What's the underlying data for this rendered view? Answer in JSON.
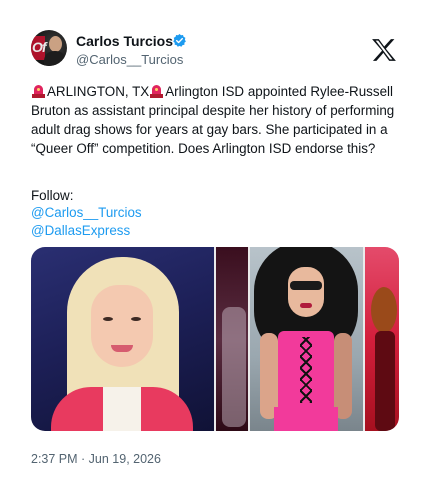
{
  "author": {
    "name": "Carlos Turcios",
    "handle": "@Carlos__Turcios",
    "verified": true
  },
  "tweet": {
    "line_segments": {
      "location": "ARLINGTON, TX",
      "text": "Arlington ISD appointed Rylee-Russell Bruton as assistant principal despite her history of performing adult drag shows for years at gay bars. She participated in a “Queer Off” competition. Does Arlington ISD endorse this?"
    },
    "follow_label": "Follow:",
    "links": [
      "@Carlos__Turcios",
      "@DallasExpress"
    ],
    "timestamp": "2:37 PM · Jun 19, 2026"
  },
  "icons": {
    "verified": "verified-badge-icon",
    "platform": "x-logo-icon",
    "emoji": "police-siren-icon"
  },
  "colors": {
    "link": "#1d9bf0",
    "secondary_text": "#536471",
    "verified": "#1d9bf0"
  }
}
